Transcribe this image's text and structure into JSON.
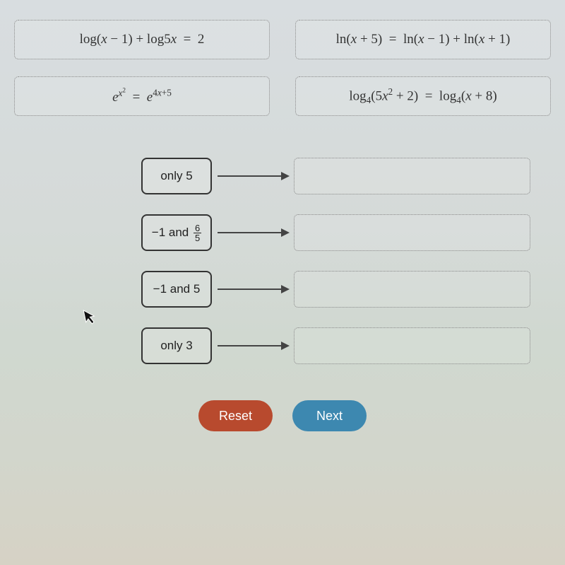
{
  "equations": {
    "topLeft_plain": "log(x − 1) + log5x = 2",
    "topRight_plain": "ln(x + 5) = ln(x − 1) + ln(x + 1)",
    "botLeft_plain": "e^{x^2} = e^{4x+5}",
    "botRight_plain": "log_4(5x^2 + 2) = log_4(x + 8)"
  },
  "sources": [
    {
      "label": "only 5"
    },
    {
      "label_prefix": "−1 and ",
      "frac_num": "6",
      "frac_den": "5"
    },
    {
      "label": "−1 and 5"
    },
    {
      "label": "only 3"
    }
  ],
  "buttons": {
    "reset": "Reset",
    "next": "Next"
  }
}
